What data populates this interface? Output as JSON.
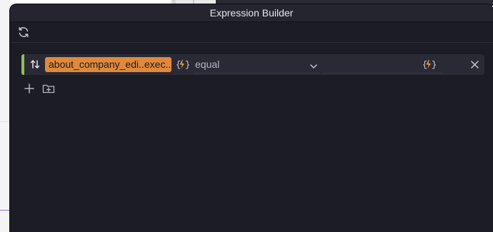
{
  "window": {
    "title": "Expression Builder"
  },
  "toolbar": {
    "refresh_icon": "refresh-icon"
  },
  "condition": {
    "field": "about_company_edi..exec...",
    "operator": "equal",
    "value": "",
    "accent_color": "#8fbf5a",
    "chip_color": "#e0893d",
    "expression_icon_color": "#e8a23c"
  },
  "actions": {
    "add_icon": "plus-icon",
    "add_group_icon": "folder-plus-icon"
  }
}
